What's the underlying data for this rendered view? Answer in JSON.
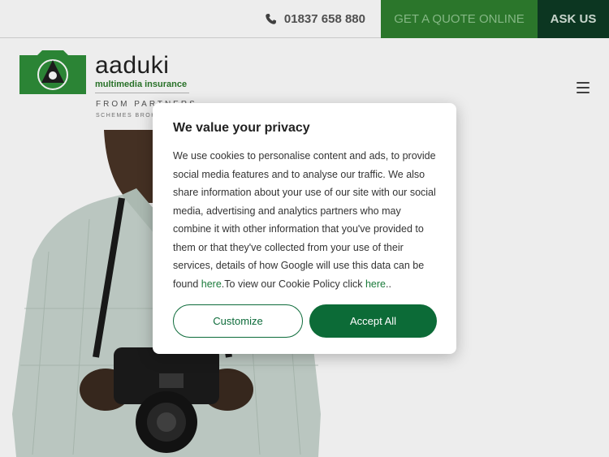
{
  "topbar": {
    "phone_icon": "phone-icon",
    "phone_number": "01837 658 880",
    "quote_label": "GET A QUOTE ONLINE",
    "ask_label": "ASK US"
  },
  "header": {
    "logo_icon": "camera-logo-icon",
    "brand": "aaduki",
    "tagline": "multimedia insurance",
    "from_partners": "FROM PARTNERS",
    "schemes": "SCHEMES BROKERS",
    "menu_icon": "hamburger-menu-icon"
  },
  "modal": {
    "title": "We value your privacy",
    "body_part1": "We use cookies to personalise content and ads, to provide social media features and to analyse our traffic. We also share information about your use of our site with our social media, advertising and analytics partners who may combine it with other information that you've provided to them or that they've collected from your use of their services, details of how Google will use this data can be found ",
    "link1": "here",
    "body_part2": ".To view our Cookie Policy click ",
    "link2": "here",
    "body_part3": "..",
    "customize_label": "Customize",
    "accept_label": "Accept All"
  },
  "colors": {
    "quote_bg": "#2f7f2f",
    "ask_bg": "#0d3b24",
    "accent_green": "#0c6b37",
    "logo_green": "#2f8f3a"
  }
}
